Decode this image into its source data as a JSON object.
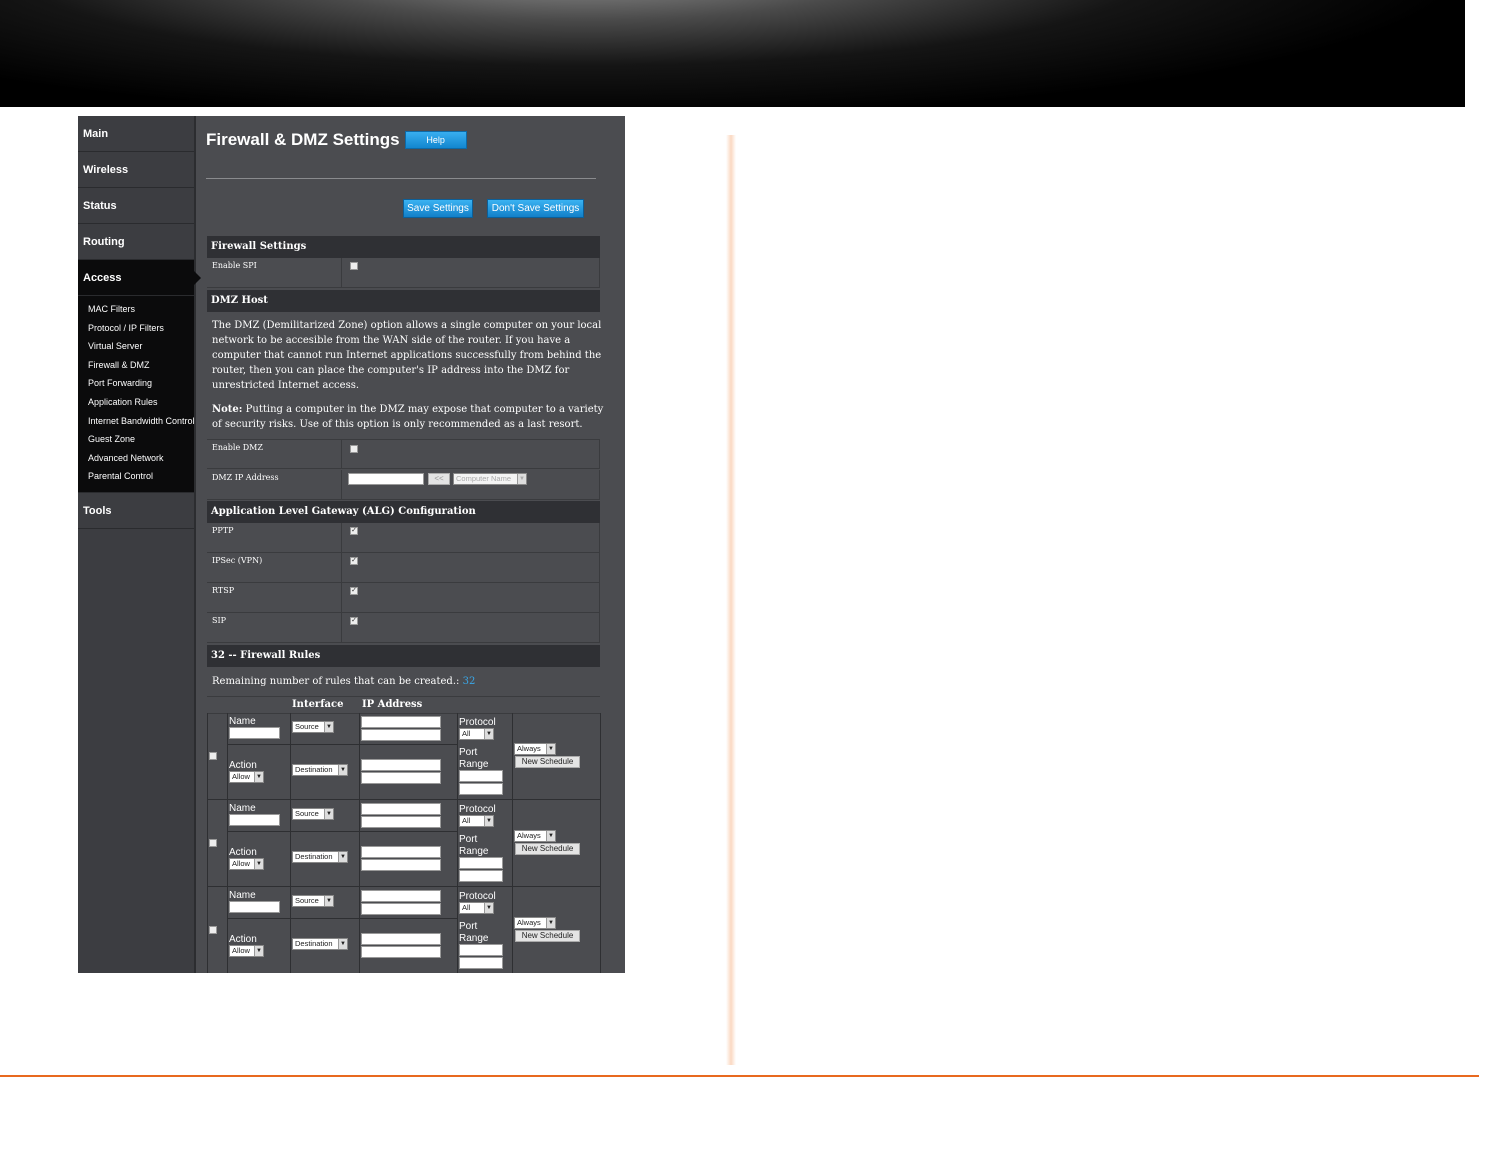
{
  "sidebar": {
    "main": "Main",
    "wireless": "Wireless",
    "status": "Status",
    "routing": "Routing",
    "access": "Access",
    "access_items": [
      "MAC Filters",
      "Protocol / IP Filters",
      "Virtual Server",
      "Firewall & DMZ",
      "Port Forwarding",
      "Application Rules",
      "Internet Bandwidth Control",
      "Guest Zone",
      "Advanced Network",
      "Parental Control"
    ],
    "tools": "Tools"
  },
  "header": {
    "title": "Firewall & DMZ Settings",
    "help": "Help",
    "save": "Save Settings",
    "dont_save": "Don't Save Settings"
  },
  "firewall": {
    "heading": "Firewall Settings",
    "enable_spi_label": "Enable SPI",
    "enable_spi_checked": false
  },
  "dmz": {
    "heading": "DMZ Host",
    "description": "The DMZ (Demilitarized Zone) option allows a single computer on your local network to be accesible from the WAN side of the router. If you have a computer that cannot run Internet applications successfully from behind the router, then you can place the computer's IP address into the DMZ for unrestricted Internet access.",
    "note_label": "Note:",
    "note_text": " Putting a computer in the DMZ may expose that computer to a variety of security risks. Use of this option is only recommended as a last resort.",
    "enable_dmz_label": "Enable DMZ",
    "ip_label": "DMZ IP Address",
    "copy_button": "<<",
    "computer_name": "Computer Name"
  },
  "alg": {
    "heading": "Application Level Gateway (ALG) Configuration",
    "items": [
      {
        "label": "PPTP",
        "checked": true
      },
      {
        "label": "IPSec (VPN)",
        "checked": true
      },
      {
        "label": "RTSP",
        "checked": true
      },
      {
        "label": "SIP",
        "checked": true
      }
    ]
  },
  "rules": {
    "heading": "32 -- Firewall Rules",
    "remaining_label": "Remaining number of rules that can be created.:",
    "remaining_value": "32",
    "col_interface": "Interface",
    "col_ip": "IP Address",
    "name_label": "Name",
    "action_label": "Action",
    "protocol_label": "Protocol",
    "port_label": "Port",
    "range_label": "Range",
    "source": "Source",
    "destination": "Destination",
    "allow": "Allow",
    "all": "All",
    "always": "Always",
    "new_schedule": "New Schedule"
  }
}
